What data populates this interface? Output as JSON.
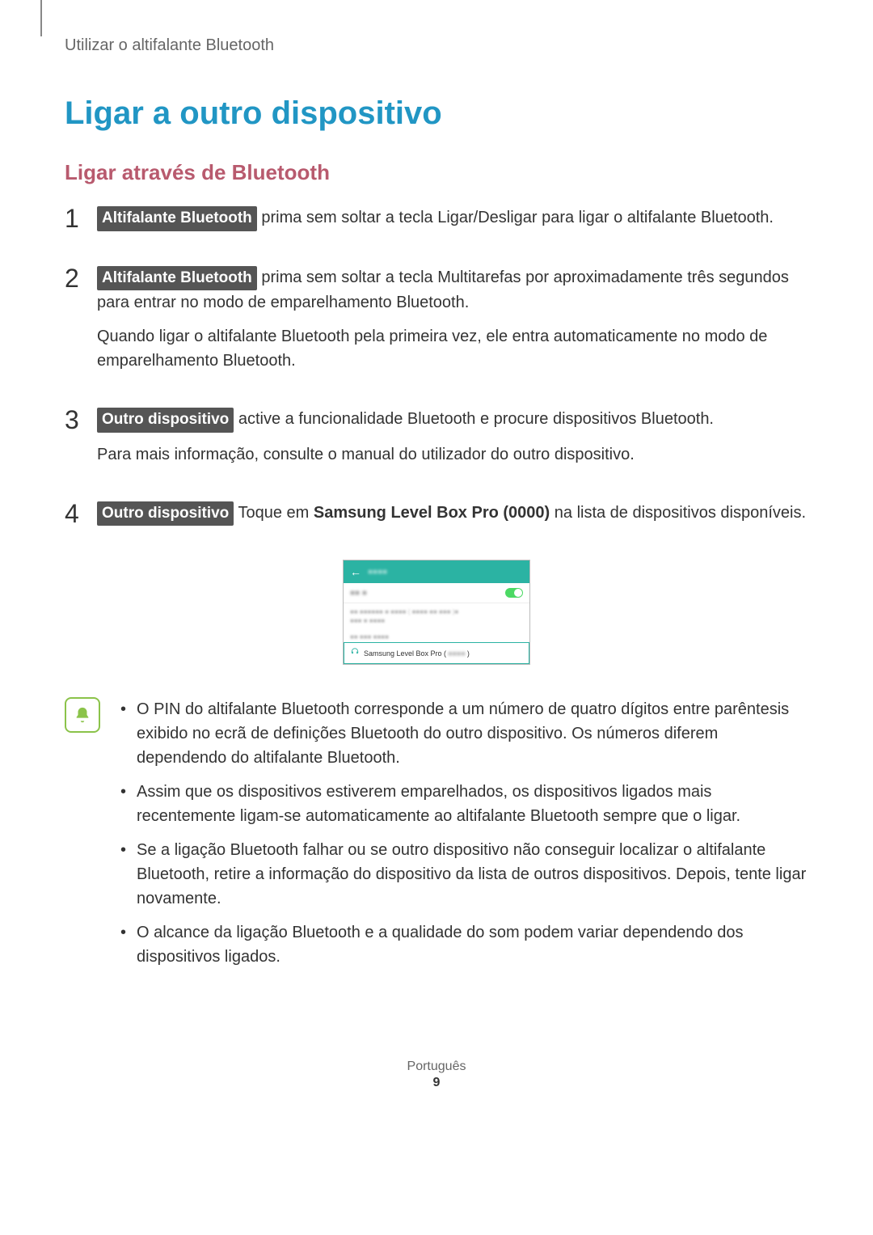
{
  "header": "Utilizar o altifalante Bluetooth",
  "title": "Ligar a outro dispositivo",
  "subtitle": "Ligar através de Bluetooth",
  "steps": [
    {
      "num": "1",
      "tag": "Altifalante Bluetooth",
      "text_after": " prima sem soltar a tecla Ligar/Desligar para ligar o altifalante Bluetooth."
    },
    {
      "num": "2",
      "tag": "Altifalante Bluetooth",
      "text_after": " prima sem soltar a tecla Multitarefas por aproximadamente três segundos para entrar no modo de emparelhamento Bluetooth.",
      "extra": "Quando ligar o altifalante Bluetooth pela primeira vez, ele entra automaticamente no modo de emparelhamento Bluetooth."
    },
    {
      "num": "3",
      "tag": "Outro dispositivo",
      "text_after": " active a funcionalidade Bluetooth e procure dispositivos Bluetooth.",
      "extra": "Para mais informação, consulte o manual do utilizador do outro dispositivo."
    },
    {
      "num": "4",
      "tag": "Outro dispositivo",
      "text_before": " Toque em ",
      "bold": "Samsung Level Box Pro (0000)",
      "text_after": " na lista de dispositivos disponíveis."
    }
  ],
  "screenshot": {
    "device_prefix": "Samsung Level Box Pro ("
  },
  "notes": [
    "O PIN do altifalante Bluetooth corresponde a um número de quatro dígitos entre parêntesis exibido no ecrã de definições Bluetooth do outro dispositivo. Os números diferem dependendo do altifalante Bluetooth.",
    "Assim que os dispositivos estiverem emparelhados, os dispositivos ligados mais recentemente ligam-se automaticamente ao altifalante Bluetooth sempre que o ligar.",
    "Se a ligação Bluetooth falhar ou se outro dispositivo não conseguir localizar o altifalante Bluetooth, retire a informação do dispositivo da lista de outros dispositivos. Depois, tente ligar novamente.",
    "O alcance da ligação Bluetooth e a qualidade do som podem variar dependendo dos dispositivos ligados."
  ],
  "footer": {
    "lang": "Português",
    "page": "9"
  }
}
